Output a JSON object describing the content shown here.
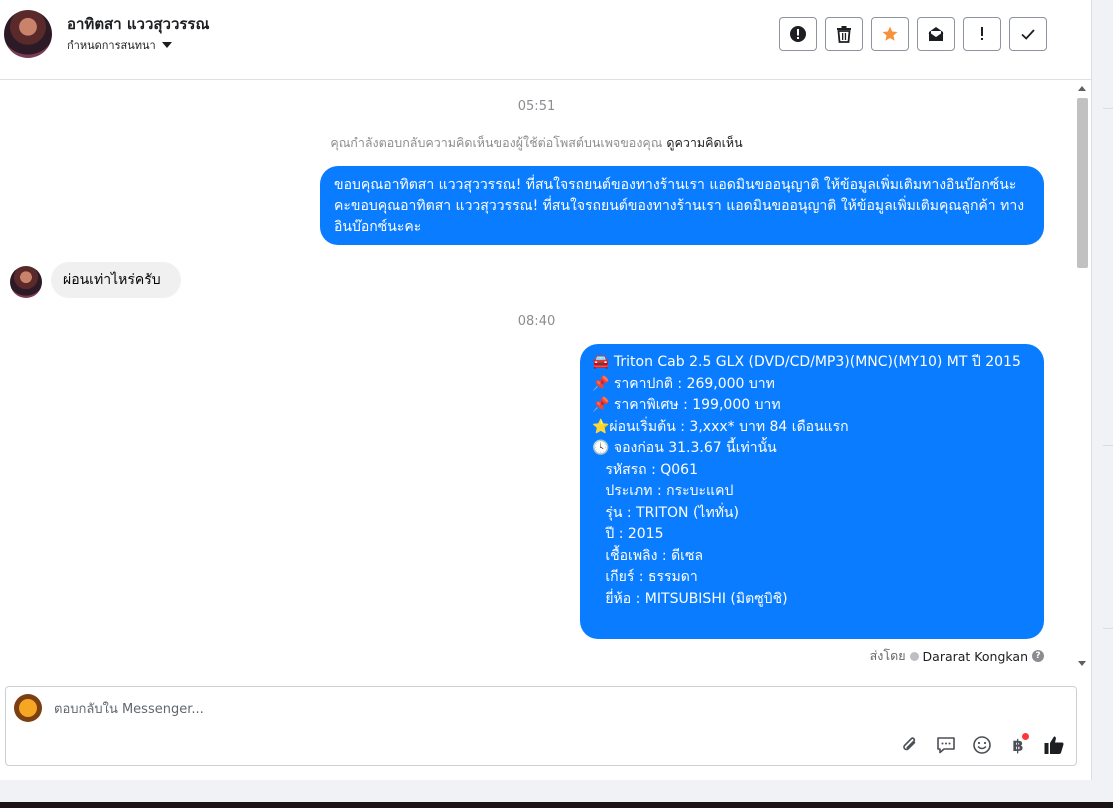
{
  "header": {
    "contact_name": "อาทิตสา แววสุววรรณ",
    "conversation_menu": "กำหนดการสนทนา",
    "toolbar": [
      {
        "name": "report-button",
        "icon": "exclamation-circle-icon"
      },
      {
        "name": "delete-button",
        "icon": "trash-icon"
      },
      {
        "name": "star-button",
        "icon": "star-icon"
      },
      {
        "name": "mark-unread-button",
        "icon": "envelope-icon"
      },
      {
        "name": "important-button",
        "icon": "exclamation-icon"
      },
      {
        "name": "done-button",
        "icon": "check-icon"
      }
    ]
  },
  "thread": {
    "timestamp_1": "05:51",
    "notice_text": "คุณกำลังตอบกลับความคิดเห็นของผู้ใช้ต่อโพสต์บนเพจของคุณ",
    "notice_link": "ดูความคิดเห็น",
    "message_1": "ขอบคุณอาทิตสา แววสุววรรณ! ที่สนใจรถยนต์ของทางร้านเรา แอดมินขออนุญาติ ให้ข้อมูลเพิ่มเติมทางอินบ๊อกซ์นะคะขอบคุณอาทิตสา แววสุววรรณ! ที่สนใจรถยนต์ของทางร้านเรา แอดมินขออนุญาติ ให้ข้อมูลเพิ่มเติมคุณลูกค้า ทางอินบ๊อกซ์นะคะ",
    "message_2": "ผ่อนเท่าไหร่ครับ",
    "timestamp_2": "08:40",
    "message_3_lines": [
      "🚘 Triton Cab 2.5 GLX (DVD/CD/MP3)(MNC)(MY10) MT ปี 2015",
      "📌 ราคาปกติ : 269,000 บาท",
      "📌 ราคาพิเศษ : 199,000 บาท",
      "⭐ผ่อนเริ่มต้น : 3,xxx* บาท 84 เดือนแรก",
      "🕓 จองก่อน 31.3.67 นี้เท่านั้น",
      "",
      "   รหัสรถ : Q061",
      "   ประเภท : กระบะแคป",
      "   รุ่น : TRITON (ไททั่น)",
      "   ปี : 2015",
      "   เชื้อเพลิง : ดีเซล",
      "   เกียร์ : ธรรมดา",
      "   ยี่ห้อ : MITSUBISHI (มิตซูบิชิ)"
    ],
    "sent_by_label": "ส่งโดย",
    "sent_by_name": "Dararat Kongkan"
  },
  "composer": {
    "placeholder": "ตอบกลับใน Messenger...",
    "value": "",
    "baht_symbol": "฿"
  },
  "colors": {
    "outgoing_bubble": "#0a7cff",
    "incoming_bubble": "#f0f0f0",
    "star": "#f7923a"
  }
}
